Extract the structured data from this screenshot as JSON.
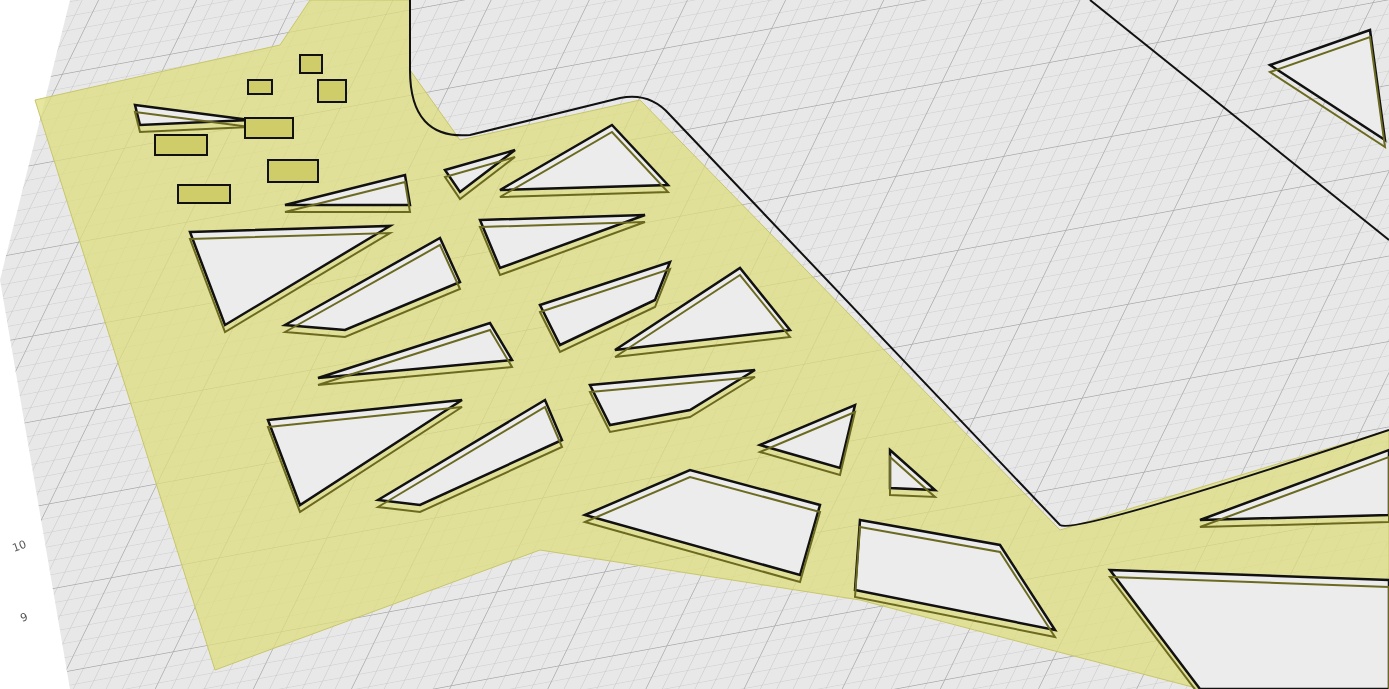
{
  "viewport": {
    "axis_labels": [
      "10",
      "9"
    ]
  }
}
